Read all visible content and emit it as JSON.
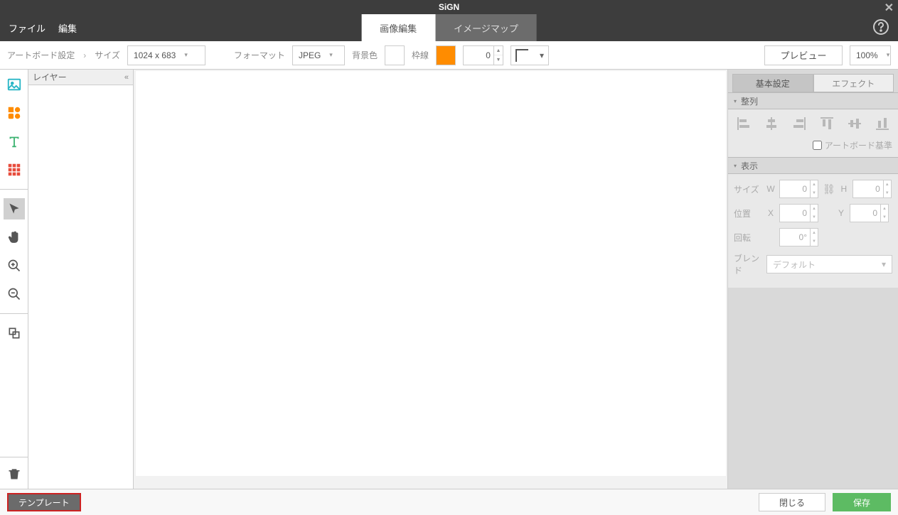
{
  "title": "SiGN",
  "menu": {
    "file": "ファイル",
    "edit": "編集"
  },
  "tabs": {
    "image_edit": "画像編集",
    "image_map": "イメージマップ"
  },
  "toolbar": {
    "artboard_settings": "アートボード設定",
    "size_label": "サイズ",
    "size_value": "1024 x 683",
    "format_label": "フォーマット",
    "format_value": "JPEG",
    "bgcolor_label": "背景色",
    "border_label": "枠線",
    "border_value": "0",
    "preview": "プレビュー",
    "zoom": "100%"
  },
  "layer": {
    "title": "レイヤー"
  },
  "right": {
    "tab_basic": "基本設定",
    "tab_effect": "エフェクト",
    "sec_align": "整列",
    "artboard_ref": "アートボード基準",
    "sec_display": "表示",
    "size": "サイズ",
    "w": "W",
    "h": "H",
    "w_val": "0",
    "h_val": "0",
    "pos": "位置",
    "x": "X",
    "y": "Y",
    "x_val": "0",
    "y_val": "0",
    "rotation": "回転",
    "rot_val": "0°",
    "blend": "ブレンド",
    "blend_val": "デフォルト"
  },
  "footer": {
    "template": "テンプレート",
    "close": "閉じる",
    "save": "保存"
  },
  "colors": {
    "bg_swatch": "#ffffff",
    "border_swatch": "#ff8c00"
  }
}
